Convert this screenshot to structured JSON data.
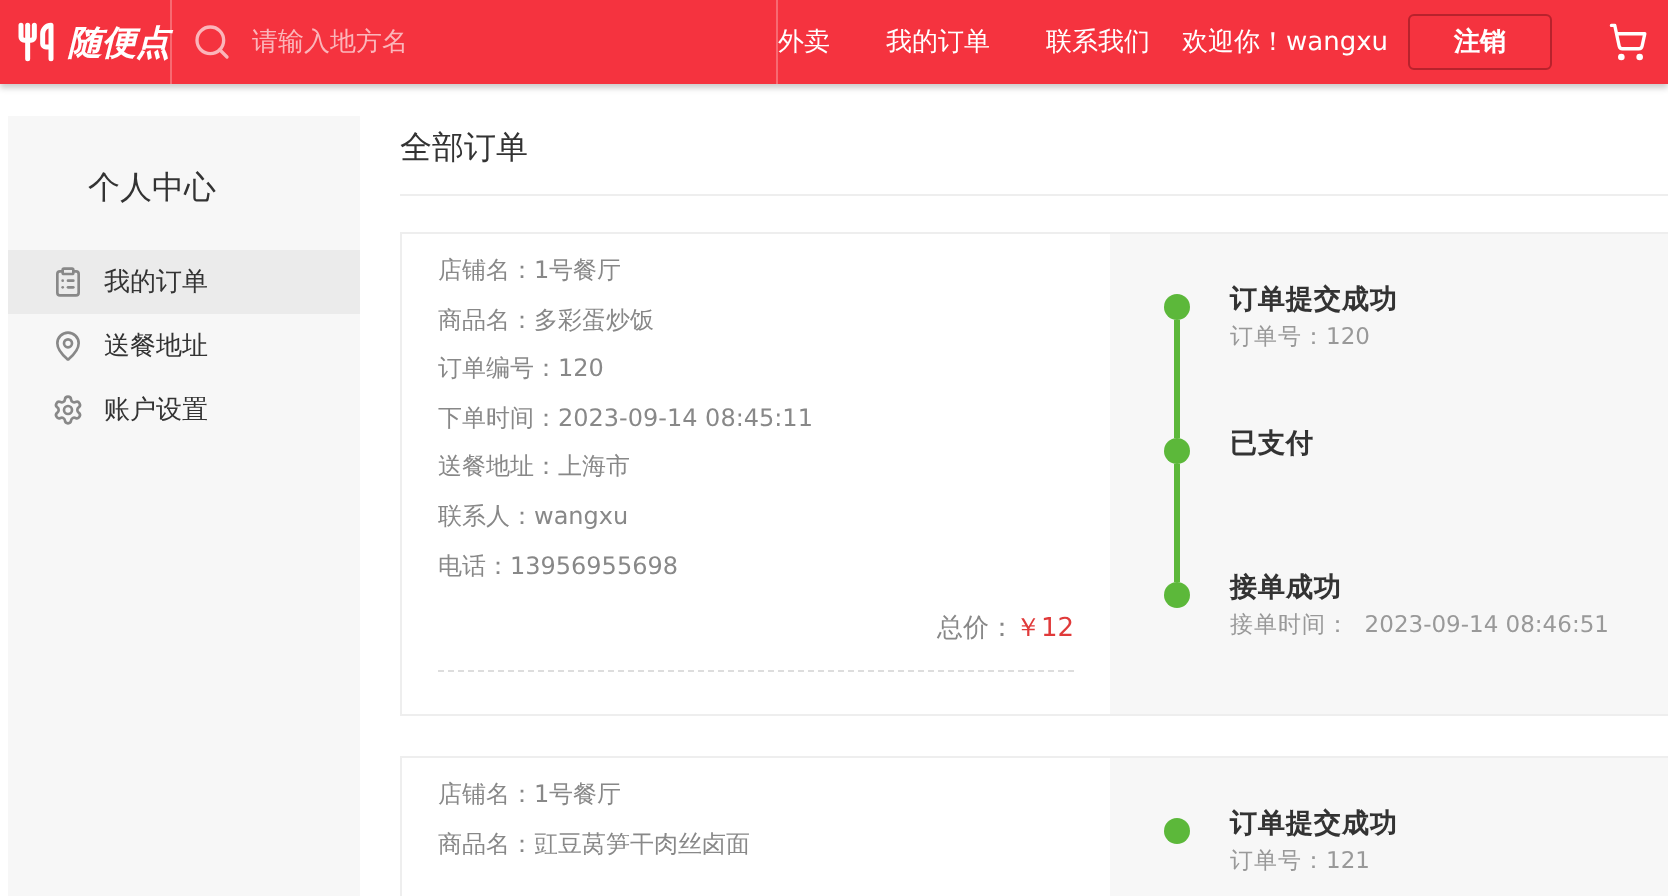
{
  "header": {
    "logo": "随便点",
    "search": {
      "placeholder": "请输入地方名"
    },
    "nav": [
      "外卖",
      "我的订单",
      "联系我们"
    ],
    "welcome": "欢迎你！wangxu",
    "logout": "注销"
  },
  "sidebar": {
    "title": "个人中心",
    "items": [
      {
        "label": "我的订单",
        "kind": "clipboard",
        "selected": true
      },
      {
        "label": "送餐地址",
        "kind": "pin",
        "selected": false
      },
      {
        "label": "账户设置",
        "kind": "gear",
        "selected": false
      }
    ]
  },
  "main": {
    "title": "全部订单",
    "orders": [
      {
        "fields": [
          "店铺名：1号餐厅",
          "商品名：多彩蛋炒饭",
          "订单编号：120",
          "下单时间：2023-09-14 08:45:11",
          "送餐地址：上海市",
          "联系人：wangxu",
          "电话：13956955698"
        ],
        "total_label": "总价：",
        "total": "￥12",
        "steps": [
          {
            "title": "订单提交成功",
            "detail": "订单号：120"
          },
          {
            "title": "已支付"
          },
          {
            "title": "接单成功",
            "detail": "接单时间：  2023-09-14 08:46:51"
          }
        ]
      },
      {
        "fields": [
          "店铺名：1号餐厅",
          "商品名：豇豆莴笋干肉丝卤面"
        ],
        "steps": [
          {
            "title": "订单提交成功",
            "detail": "订单号：121"
          }
        ]
      }
    ]
  }
}
